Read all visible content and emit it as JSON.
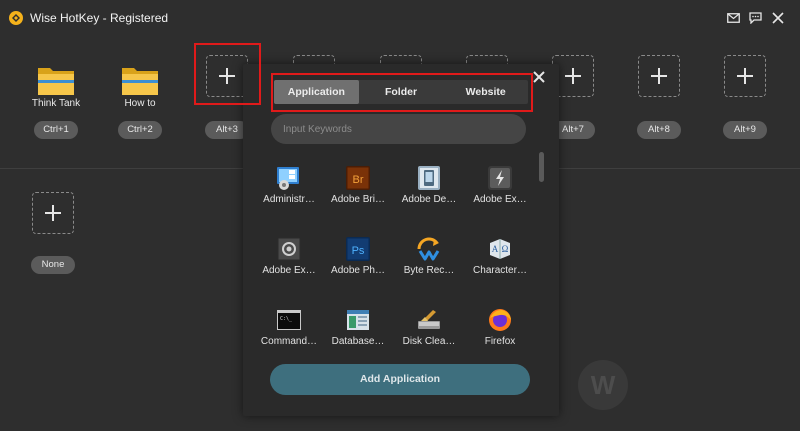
{
  "app": {
    "title": "Wise HotKey - Registered"
  },
  "window_controls": {
    "mail": "mail-icon",
    "feedback": "chat-icon",
    "close": "close-icon"
  },
  "slots": [
    {
      "name": "Think Tank",
      "key": "Ctrl+1",
      "icon": "folder-icon"
    },
    {
      "name": "How to",
      "key": "Ctrl+2",
      "icon": "folder-icon"
    },
    {
      "name": "",
      "key": "Alt+3",
      "icon": "plus-icon"
    },
    {
      "name": "",
      "key": "Alt+7",
      "icon": "plus-icon"
    },
    {
      "name": "",
      "key": "Alt+8",
      "icon": "plus-icon"
    },
    {
      "name": "",
      "key": "Alt+9",
      "icon": "plus-icon"
    },
    {
      "name": "",
      "key": "None",
      "icon": "plus-icon"
    }
  ],
  "popup": {
    "tabs": [
      "Application",
      "Folder",
      "Website"
    ],
    "active_tab": "Application",
    "search_placeholder": "Input Keywords",
    "apps": [
      {
        "label": "Administr…",
        "icon": "administrative-tools-icon"
      },
      {
        "label": "Adobe Bri…",
        "icon": "adobe-bridge-icon"
      },
      {
        "label": "Adobe De…",
        "icon": "adobe-device-central-icon"
      },
      {
        "label": "Adobe Ex…",
        "icon": "adobe-extension-icon"
      },
      {
        "label": "Adobe Ex…",
        "icon": "adobe-extendscript-icon"
      },
      {
        "label": "Adobe Ph…",
        "icon": "adobe-photoshop-icon"
      },
      {
        "label": "Byte Rec…",
        "icon": "byte-recovery-icon"
      },
      {
        "label": "Character…",
        "icon": "character-map-icon"
      },
      {
        "label": "Command…",
        "icon": "command-prompt-icon"
      },
      {
        "label": "Database…",
        "icon": "database-icon"
      },
      {
        "label": "Disk Clea…",
        "icon": "disk-cleanup-icon"
      },
      {
        "label": "Firefox",
        "icon": "firefox-icon"
      }
    ],
    "add_button": "Add Application"
  },
  "colors": {
    "accent_button": "#3e6f7e",
    "highlight_box": "#e01a1a",
    "background": "#2e2e2e"
  }
}
